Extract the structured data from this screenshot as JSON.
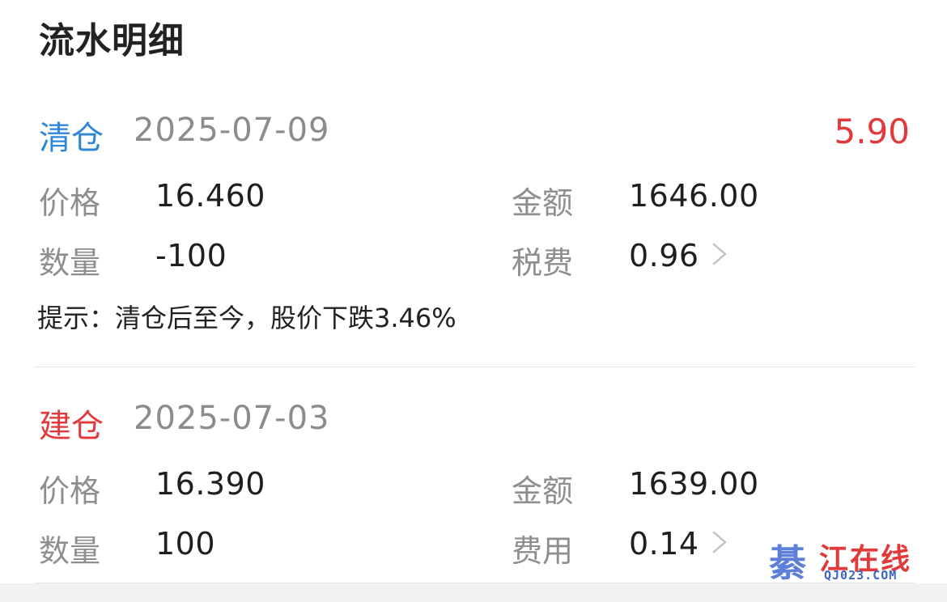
{
  "header": {
    "title": "流水明细"
  },
  "records": [
    {
      "type": "清仓",
      "date": "2025-07-09",
      "profit": "5.90",
      "price_label": "价格",
      "price": "16.460",
      "amount_label": "金额",
      "amount": "1646.00",
      "quantity_label": "数量",
      "quantity": "-100",
      "fee_label": "税费",
      "fee": "0.96",
      "tip": "提示：清仓后至今，股价下跌3.46%"
    },
    {
      "type": "建仓",
      "date": "2025-07-03",
      "price_label": "价格",
      "price": "16.390",
      "amount_label": "金额",
      "amount": "1639.00",
      "quantity_label": "数量",
      "quantity": "100",
      "fee_label": "费用",
      "fee": "0.14"
    }
  ],
  "watermark": {
    "char": "綦",
    "text": "江在线",
    "domain": "QJ023.COM"
  },
  "colors": {
    "close_type": "#2f86d6",
    "open_type": "#e23a3a",
    "profit": "#e23a3a",
    "label": "#8e8e8e",
    "date": "#8c8c8c"
  },
  "icons": {
    "fee_detail": "chevron-right-icon"
  }
}
